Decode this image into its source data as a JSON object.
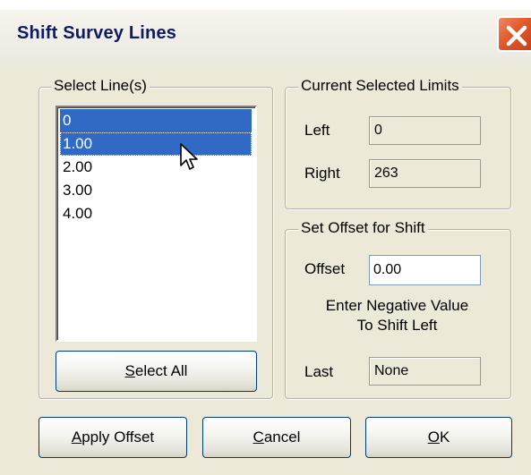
{
  "window": {
    "title": "Shift Survey Lines"
  },
  "select_lines": {
    "legend": "Select Line(s)",
    "items": [
      {
        "label": "0",
        "selected": true
      },
      {
        "label": "1.00",
        "selected": true
      },
      {
        "label": "2.00",
        "selected": false
      },
      {
        "label": "3.00",
        "selected": false
      },
      {
        "label": "4.00",
        "selected": false
      }
    ],
    "select_all_label": "Select All",
    "select_all_mnemonic": "S",
    "select_all_rest": "elect All"
  },
  "current_limits": {
    "legend": "Current Selected Limits",
    "left_label": "Left",
    "left_value": "0",
    "right_label": "Right",
    "right_value": "263"
  },
  "set_offset": {
    "legend": "Set Offset for Shift",
    "offset_label": "Offset",
    "offset_value": "0.00",
    "hint_line1": "Enter Negative Value",
    "hint_line2": "To Shift Left",
    "last_label": "Last",
    "last_value": "None"
  },
  "buttons": {
    "apply": {
      "mnemonic": "A",
      "rest": "pply Offset"
    },
    "cancel": {
      "mnemonic": "C",
      "rest": "ancel"
    },
    "ok": {
      "mnemonic": "O",
      "rest": "K"
    }
  },
  "colors": {
    "dialog_bg": "#ece9d8",
    "selection": "#316ac5",
    "title_text": "#0f1b5f",
    "close_button": "#e15a2c"
  },
  "icons": [
    "close-icon",
    "mouse-pointer-icon"
  ]
}
